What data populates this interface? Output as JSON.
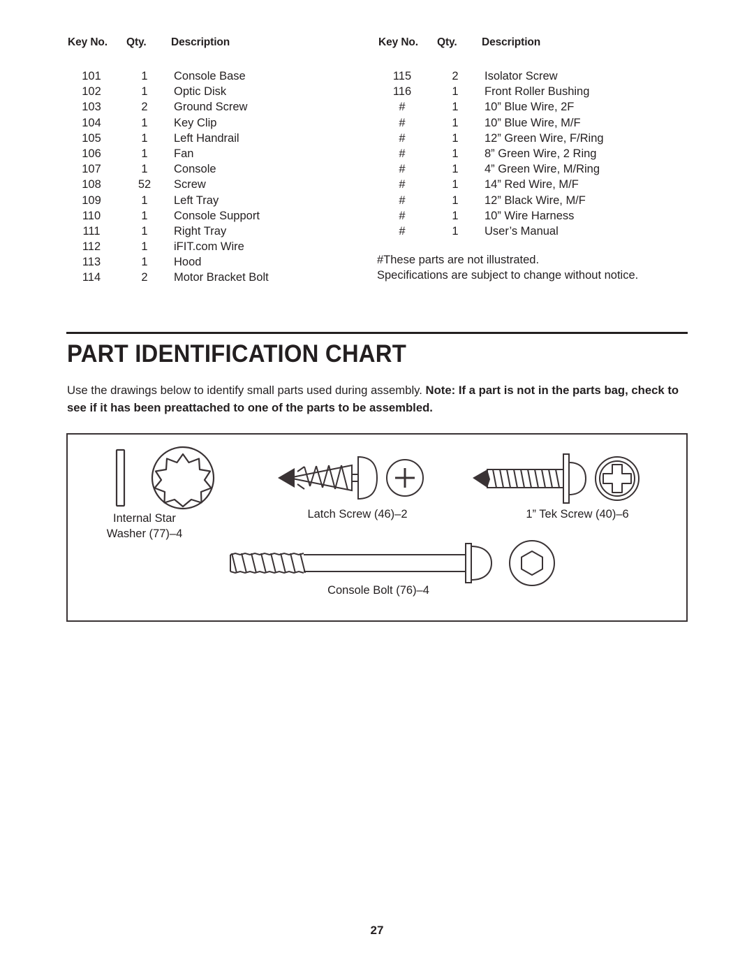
{
  "parts_list": {
    "headers": [
      "Key No.",
      "Qty.",
      "Description"
    ],
    "left_column": [
      {
        "key": "101",
        "qty": "1",
        "desc": "Console Base"
      },
      {
        "key": "102",
        "qty": "1",
        "desc": "Optic Disk"
      },
      {
        "key": "103",
        "qty": "2",
        "desc": "Ground Screw"
      },
      {
        "key": "104",
        "qty": "1",
        "desc": "Key Clip"
      },
      {
        "key": "105",
        "qty": "1",
        "desc": "Left Handrail"
      },
      {
        "key": "106",
        "qty": "1",
        "desc": "Fan"
      },
      {
        "key": "107",
        "qty": "1",
        "desc": "Console"
      },
      {
        "key": "108",
        "qty": "52",
        "desc": "Screw"
      },
      {
        "key": "109",
        "qty": "1",
        "desc": "Left Tray"
      },
      {
        "key": "110",
        "qty": "1",
        "desc": "Console Support"
      },
      {
        "key": "111",
        "qty": "1",
        "desc": "Right Tray"
      },
      {
        "key": "112",
        "qty": "1",
        "desc": "iFIT.com Wire"
      },
      {
        "key": "113",
        "qty": "1",
        "desc": "Hood"
      },
      {
        "key": "114",
        "qty": "2",
        "desc": "Motor Bracket Bolt"
      }
    ],
    "right_column": [
      {
        "key": "115",
        "qty": "2",
        "desc": "Isolator Screw"
      },
      {
        "key": "116",
        "qty": "1",
        "desc": "Front Roller Bushing"
      },
      {
        "key": "#",
        "qty": "1",
        "desc": "10” Blue Wire, 2F"
      },
      {
        "key": "#",
        "qty": "1",
        "desc": "10” Blue Wire, M/F"
      },
      {
        "key": "#",
        "qty": "1",
        "desc": "12” Green Wire, F/Ring"
      },
      {
        "key": "#",
        "qty": "1",
        "desc": "8” Green Wire, 2 Ring"
      },
      {
        "key": "#",
        "qty": "1",
        "desc": "4” Green Wire, M/Ring"
      },
      {
        "key": "#",
        "qty": "1",
        "desc": "14” Red Wire, M/F"
      },
      {
        "key": "#",
        "qty": "1",
        "desc": "12” Black Wire, M/F"
      },
      {
        "key": "#",
        "qty": "1",
        "desc": "10” Wire Harness"
      },
      {
        "key": "#",
        "qty": "1",
        "desc": "User’s Manual"
      }
    ],
    "footnotes": [
      "#These parts are not illustrated.",
      "Specifications are subject to change without notice."
    ]
  },
  "section": {
    "title": "PART IDENTIFICATION CHART",
    "intro_plain": "Use the drawings below to identify small parts used during assembly. ",
    "intro_bold": "Note: If a part is not in the parts bag, check to see if it has been preattached to one of the parts to be assembled."
  },
  "part_chart": {
    "items": [
      {
        "name": "internal-star-washer",
        "caption_line1": "Internal Star",
        "caption_line2": "Washer (77)–4"
      },
      {
        "name": "latch-screw",
        "caption_line1": "Latch Screw (46)–2",
        "caption_line2": ""
      },
      {
        "name": "tek-screw",
        "caption_line1": "1” Tek Screw (40)–6",
        "caption_line2": ""
      },
      {
        "name": "console-bolt",
        "caption_line1": "Console Bolt (76)–4",
        "caption_line2": ""
      }
    ]
  },
  "page": {
    "number": "27"
  },
  "colors": {
    "ink": "#231f20",
    "line": "#3a3335"
  }
}
